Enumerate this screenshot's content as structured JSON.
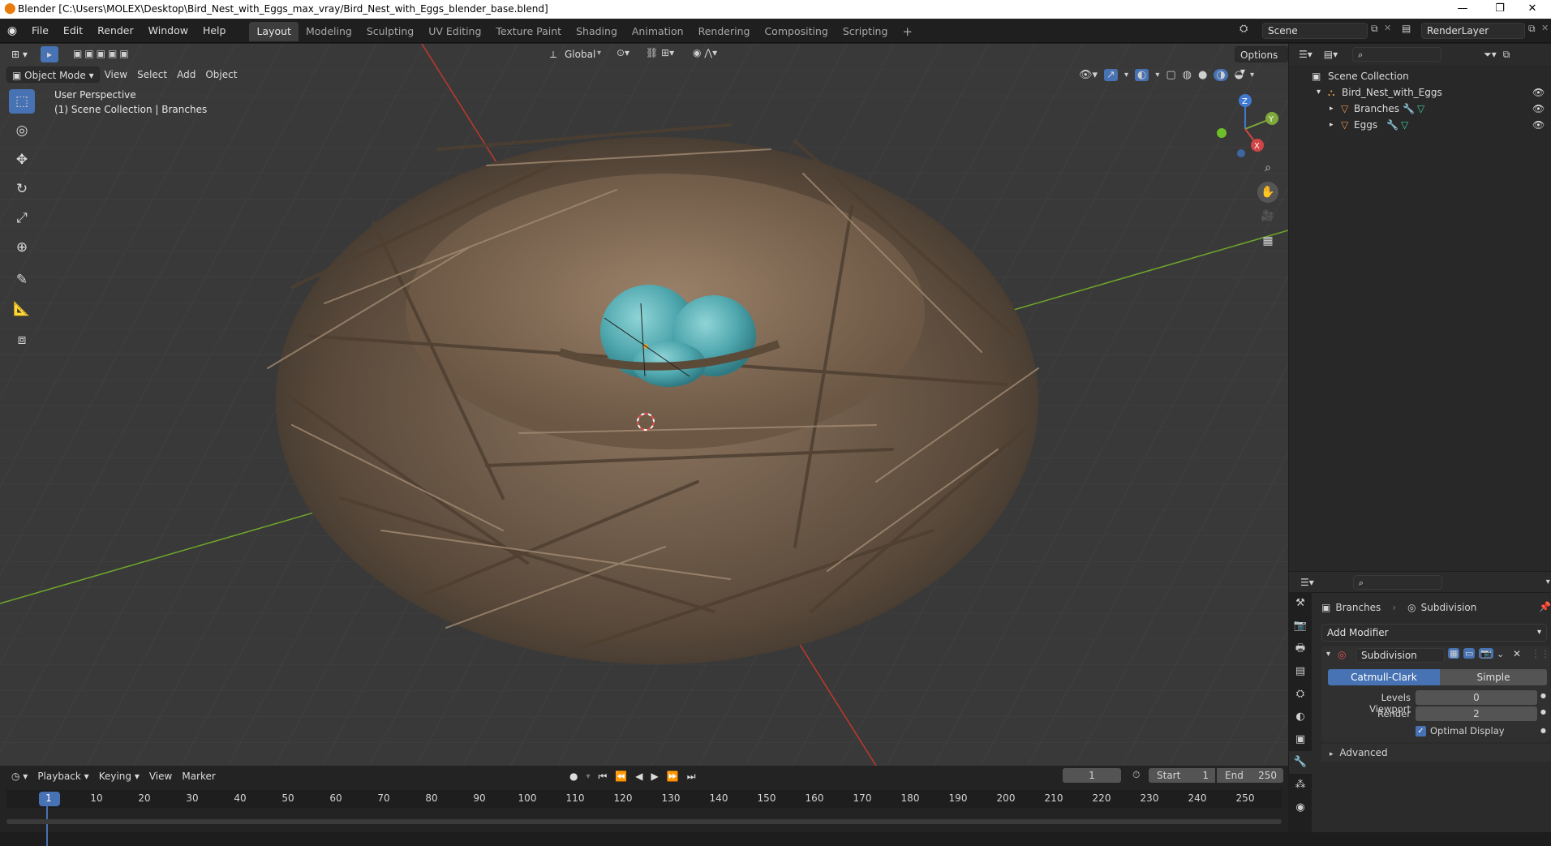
{
  "window": {
    "title": "Blender [C:\\Users\\MOLEX\\Desktop\\Bird_Nest_with_Eggs_max_vray/Bird_Nest_with_Eggs_blender_base.blend]",
    "minimize": "—",
    "maximize": "❐",
    "close": "✕"
  },
  "menu": {
    "items": [
      "File",
      "Edit",
      "Render",
      "Window",
      "Help"
    ],
    "workspaces": [
      "Layout",
      "Modeling",
      "Sculpting",
      "UV Editing",
      "Texture Paint",
      "Shading",
      "Animation",
      "Rendering",
      "Compositing",
      "Scripting"
    ],
    "active_workspace": "Layout",
    "add_workspace": "+",
    "scene": "Scene",
    "render_layer": "RenderLayer"
  },
  "viewport_header": {
    "mode": "Object Mode",
    "menus": [
      "View",
      "Select",
      "Add",
      "Object"
    ],
    "transform_orientation": "Global",
    "options": "Options"
  },
  "viewport": {
    "perspective": "User Perspective",
    "collection_info": "(1) Scene Collection | Branches",
    "gizmo": {
      "z": "Z",
      "y": "Y",
      "x": "X"
    }
  },
  "outliner": {
    "root": "Scene Collection",
    "collection": "Bird_Nest_with_Eggs",
    "objects": [
      "Branches",
      "Eggs"
    ]
  },
  "properties": {
    "breadcrumb_object": "Branches",
    "breadcrumb_modifier": "Subdivision",
    "add_modifier": "Add Modifier",
    "modifier_name": "Subdivision",
    "algorithm_options": [
      "Catmull-Clark",
      "Simple"
    ],
    "algorithm_selected": "Catmull-Clark",
    "levels_viewport_label": "Levels Viewport",
    "levels_viewport": "0",
    "render_label": "Render",
    "render_levels": "2",
    "optimal_display_label": "Optimal Display",
    "optimal_display": true,
    "advanced_label": "Advanced"
  },
  "timeline": {
    "menus": [
      "Playback",
      "Keying",
      "View",
      "Marker"
    ],
    "current_frame": "1",
    "start_label": "Start",
    "start": "1",
    "end_label": "End",
    "end": "250",
    "ruler_ticks": [
      "1",
      "10",
      "20",
      "30",
      "40",
      "50",
      "60",
      "70",
      "80",
      "90",
      "100",
      "110",
      "120",
      "130",
      "140",
      "150",
      "160",
      "170",
      "180",
      "190",
      "200",
      "210",
      "220",
      "230",
      "240",
      "250"
    ]
  },
  "colors": {
    "accent": "#4772b3",
    "egg": "#5fb3b8",
    "nest": "#7a6450",
    "x_axis": "#c0392b",
    "y_axis": "#6ea82a"
  }
}
